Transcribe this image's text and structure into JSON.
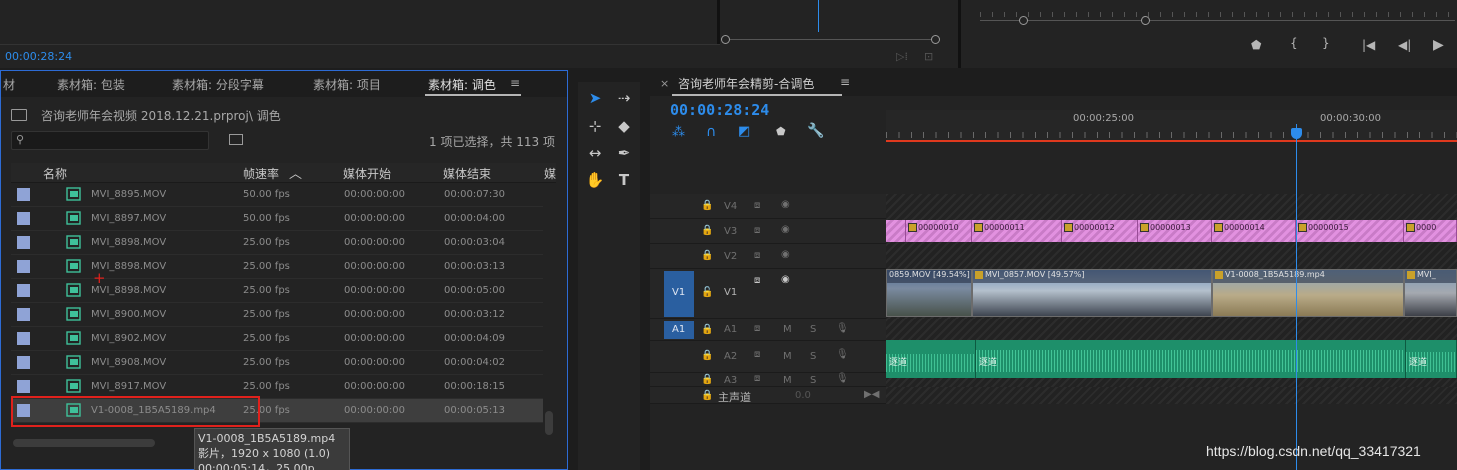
{
  "source_monitor": {
    "timecode": "00:00:28:24"
  },
  "program_transport": {
    "buttons": [
      "mark-in",
      "{",
      "}",
      "go-to-in",
      "step-back",
      "play"
    ]
  },
  "project_panel": {
    "tabs": [
      "材",
      "素材箱: 包装",
      "素材箱: 分段字幕",
      "素材箱: 项目",
      "素材箱: 调色"
    ],
    "menu_icon": "≡",
    "path": "咨询老师年会视频 2018.12.21.prproj\\ 调色",
    "search_placeholder": "",
    "selection_info": "1 项已选择，共 113 项",
    "columns": {
      "name": "名称",
      "fps": "帧速率",
      "start": "媒体开始",
      "end": "媒体结束",
      "extra": "媒"
    },
    "rows": [
      {
        "name": "MVI_8895.MOV",
        "fps": "50.00 fps",
        "start": "00:00:00:00",
        "end": "00:00:07:30"
      },
      {
        "name": "MVI_8897.MOV",
        "fps": "50.00 fps",
        "start": "00:00:00:00",
        "end": "00:00:04:00"
      },
      {
        "name": "MVI_8898.MOV",
        "fps": "25.00 fps",
        "start": "00:00:00:00",
        "end": "00:00:03:04"
      },
      {
        "name": "MVI_8898.MOV",
        "fps": "25.00 fps",
        "start": "00:00:00:00",
        "end": "00:00:03:13"
      },
      {
        "name": "MVI_8898.MOV",
        "fps": "25.00 fps",
        "start": "00:00:00:00",
        "end": "00:00:05:00"
      },
      {
        "name": "MVI_8900.MOV",
        "fps": "25.00 fps",
        "start": "00:00:00:00",
        "end": "00:00:03:12"
      },
      {
        "name": "MVI_8902.MOV",
        "fps": "25.00 fps",
        "start": "00:00:00:00",
        "end": "00:00:04:09"
      },
      {
        "name": "MVI_8908.MOV",
        "fps": "25.00 fps",
        "start": "00:00:00:00",
        "end": "00:00:04:02"
      },
      {
        "name": "MVI_8917.MOV",
        "fps": "25.00 fps",
        "start": "00:00:00:00",
        "end": "00:00:18:15"
      },
      {
        "name": "V1-0008_1B5A5189.mp4",
        "fps": "25.00 fps",
        "start": "00:00:00:00",
        "end": "00:00:05:13"
      }
    ],
    "tooltip": {
      "line1": "V1-0008_1B5A5189.mp4",
      "line2": "影片，1920 x 1080 (1.0)",
      "line3": "00:00:05:14，25.00p"
    }
  },
  "timeline": {
    "close": "×",
    "title": "咨询老师年会精剪-合调色",
    "menu_icon": "≡",
    "timecode": "00:00:28:24",
    "ruler_labels": [
      "00:00:25:00",
      "00:00:30:00"
    ],
    "tracks": {
      "v4": "V4",
      "v3": "V3",
      "v2": "V2",
      "v1_src": "V1",
      "v1": "V1",
      "a1_src": "A1",
      "a1": "A1",
      "a2": "A2",
      "a3": "A3",
      "master": "主声道",
      "master_val": "0.0",
      "mute": "M",
      "solo": "S"
    },
    "v3_clips": [
      "00000010",
      "00000011",
      "00000012",
      "00000013",
      "00000014",
      "00000015",
      "0000"
    ],
    "v1_clips": [
      "0859.MOV [49.54%]",
      "MVI_0857.MOV [49.57%]",
      "V1-0008_1B5A5189.mp4",
      "MVI_"
    ],
    "a2_clips": [
      "逐道",
      "逐道",
      "逐道"
    ]
  },
  "watermark": "https://blog.csdn.net/qq_33417321",
  "colors": {
    "accent": "#2d8ceb",
    "v3_clip": "#e291e0",
    "audio_clip": "#1e8f6a",
    "highlight": "#e0211c",
    "label": "#8fa3d6"
  }
}
